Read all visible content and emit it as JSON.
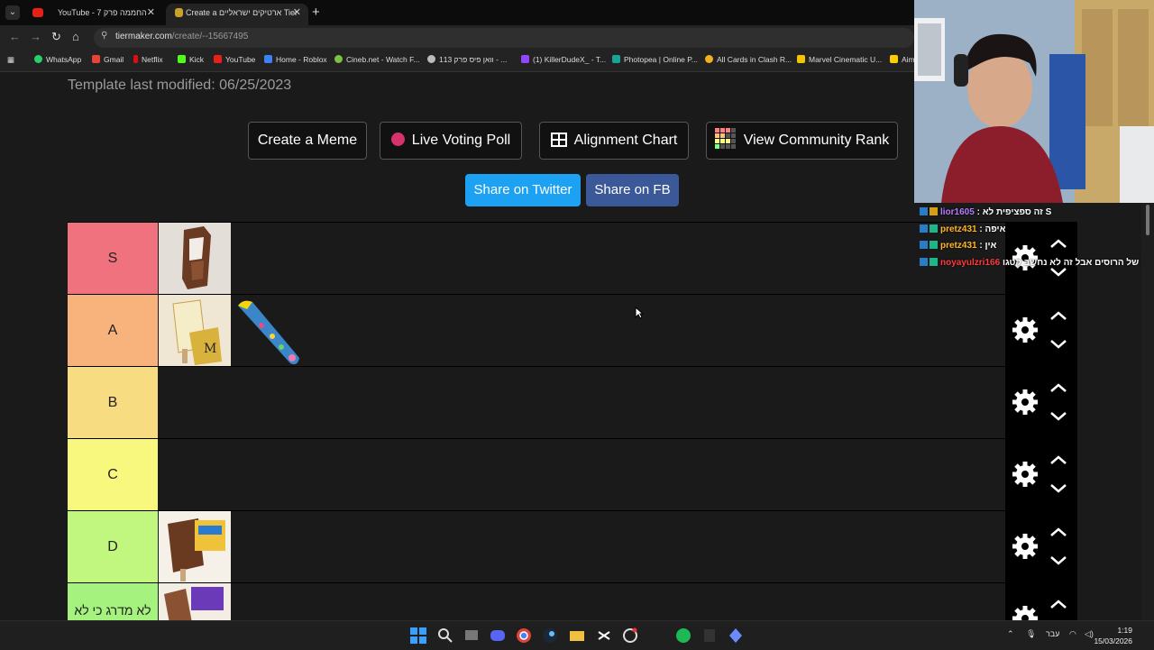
{
  "browser": {
    "tabs": [
      {
        "title": "YouTube - החממה פרק 7",
        "active": false
      },
      {
        "title": "Create a ארטיקים ישראליים Tier",
        "active": true
      }
    ],
    "url_host": "tiermaker.com",
    "url_path": "/create/--15667495",
    "bookmarks": [
      "WhatsApp",
      "Gmail",
      "Netflix",
      "Kick",
      "YouTube",
      "Home - Roblox",
      "Cineb.net - Watch F...",
      "וואן פיס פרק 113 - ...",
      "(1) KillerDudeX_ - T...",
      "Photopea | Online P...",
      "All Cards in Clash R...",
      "Marvel Cinematic U...",
      "Aim"
    ]
  },
  "page": {
    "modified_text": "Template last modified: 06/25/2023",
    "actions": {
      "create_meme": "Create a Meme",
      "live_poll": "Live Voting Poll",
      "alignment": "Alignment Chart",
      "community": "View Community Rank"
    },
    "share": {
      "twitter": "Share on Twitter",
      "fb": "Share on FB"
    }
  },
  "tiers": [
    {
      "label": "S",
      "color": "#ff7f7f"
    },
    {
      "label": "A",
      "color": "#ffbf7f"
    },
    {
      "label": "B",
      "color": "#ffdf7f"
    },
    {
      "label": "C",
      "color": "#ffff7f"
    },
    {
      "label": "D",
      "color": "#bfff7f"
    },
    {
      "label": "לא מדרג כי לא",
      "color": "#7fff7f"
    }
  ],
  "chat": [
    {
      "user": "lior1605",
      "user_color": "#b57cff",
      "msg": "זה ספציפית לא S"
    },
    {
      "user": "pretz431",
      "user_color": "#ffb627",
      "msg": "איפה"
    },
    {
      "user": "pretz431",
      "user_color": "#ffb627",
      "msg": "אין"
    },
    {
      "user": "noyayulzri166",
      "user_color": "#ff3b3b",
      "msg": "ת של הרוסים אבל זה לא נחשב קטגו"
    }
  ],
  "taskbar": {
    "lang": "עבר",
    "time": "1:19",
    "date": "15/03/2026"
  }
}
